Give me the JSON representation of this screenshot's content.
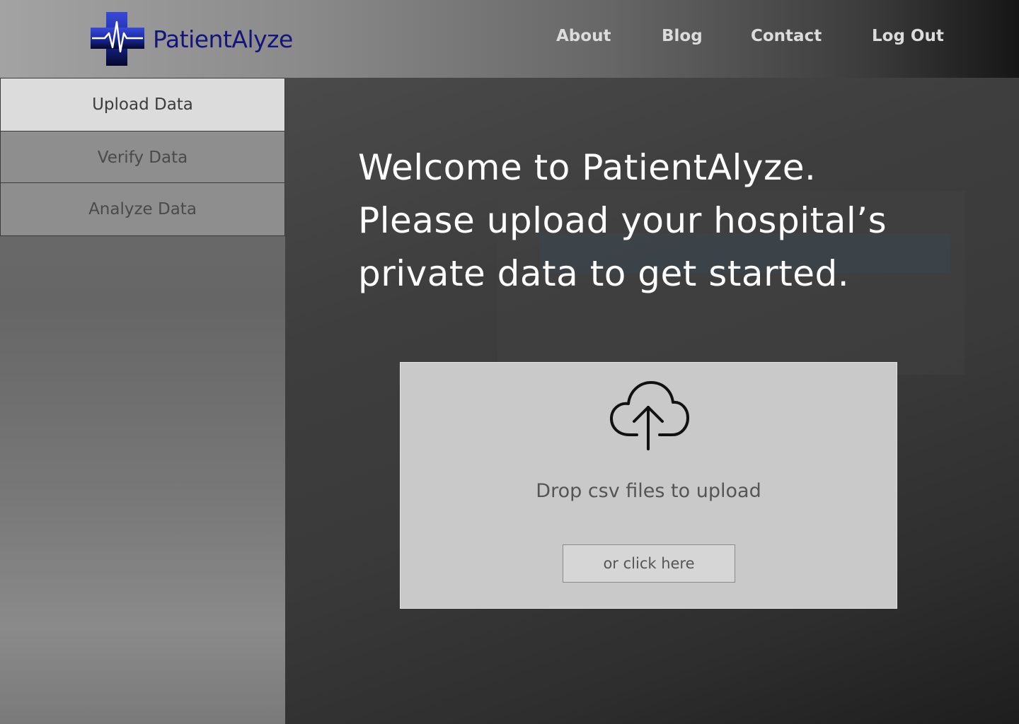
{
  "header": {
    "brand": "PatientAlyze",
    "nav": {
      "about": "About",
      "blog": "Blog",
      "contact": "Contact",
      "logout": "Log Out"
    }
  },
  "sidebar": {
    "items": [
      {
        "label": "Upload Data",
        "active": true
      },
      {
        "label": "Verify Data",
        "active": false
      },
      {
        "label": "Analyze Data",
        "active": false
      }
    ]
  },
  "main": {
    "welcome_lines": [
      "Welcome to PatientAlyze.",
      "Please upload your hospital’s",
      "private data to get started."
    ],
    "upload": {
      "icon": "cloud-upload-icon",
      "drop_text": "Drop csv files to upload",
      "button_label": "or click here"
    }
  },
  "colors": {
    "brand_text": "#14147a",
    "logo_blue": "#1a2aa8",
    "active_tab": "#dcdcdc",
    "upload_box": "#c9c9c9"
  }
}
